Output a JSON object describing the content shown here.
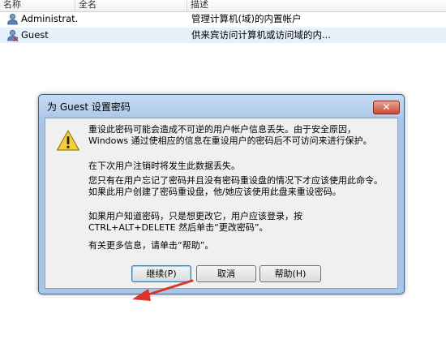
{
  "listview": {
    "columns": [
      "名称",
      "全名",
      "描述"
    ],
    "rows": [
      {
        "name": "Administrat...",
        "fullname": "",
        "desc": "管理计算机(域)的内置帐户",
        "icon": "user-icon"
      },
      {
        "name": "Guest",
        "fullname": "",
        "desc": "供来宾访问计算机或访问域的内...",
        "icon": "user-icon"
      }
    ]
  },
  "dialog": {
    "title": "为 Guest 设置密码",
    "close_label": "✕",
    "icon": "warning-icon",
    "message1": "重设此密码可能会造成不可逆的用户帐户信息丢失。由于安全原因，Windows 通过使相应的信息在重设用户的密码后不可访问来进行保护。",
    "message2": "在下次用户注销时将发生此数据丢失。",
    "message3": "您只有在用户忘记了密码并且没有密码重设盘的情况下才应该使用此命令。如果此用户创建了密码重设盘，他/她应该使用此盘来重设密码。",
    "message4": "如果用户知道密码，只是想更改它，用户应该登录，按 CTRL+ALT+DELETE 然后单击“更改密码”。",
    "message5": "有关更多信息，请单击“帮助”。",
    "buttons": {
      "continue": "继续(P)",
      "cancel": "取消",
      "help": "帮助(H)"
    }
  },
  "colors": {
    "frame": "#a9c6e6",
    "close": "#c84a35",
    "annotation_arrow": "#e0312a",
    "selection": "#e5f0fb"
  }
}
